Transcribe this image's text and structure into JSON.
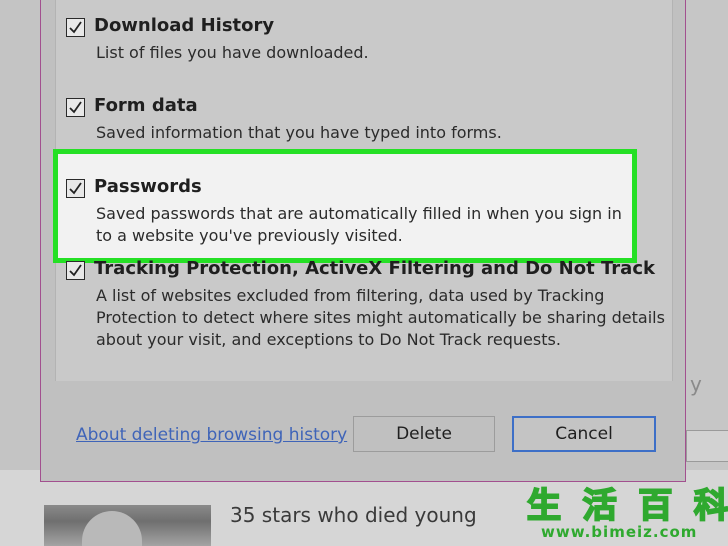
{
  "dialog": {
    "options": [
      {
        "title": "Download History",
        "description": [
          "List of files you have downloaded."
        ],
        "checked": true
      },
      {
        "title": "Form data",
        "description": [
          "Saved information that you have typed into forms."
        ],
        "checked": true
      },
      {
        "title": "Passwords",
        "description": [
          "Saved passwords that are automatically filled in when you sign in",
          "to a website you've previously visited."
        ],
        "checked": true
      },
      {
        "title": "Tracking Protection, ActiveX Filtering and Do Not Track",
        "description": [
          "A list of websites excluded from filtering, data used by Tracking",
          "Protection to detect where sites might automatically be sharing details",
          "about your visit, and exceptions to Do Not Track requests."
        ],
        "checked": true
      }
    ],
    "link_text": "About deleting browsing history",
    "delete_label": "Delete",
    "cancel_label": "Cancel"
  },
  "background": {
    "headline": "35 stars who died young",
    "right_fragment": "y"
  },
  "watermark": {
    "chars": [
      "生",
      "活",
      "百",
      "科"
    ],
    "url": "www.bimeiz.com"
  },
  "colors": {
    "highlight_border": "#25e025",
    "link": "#3f64b8",
    "cancel_border": "#3d6fc7",
    "dialog_border": "#a2508f"
  },
  "icons": {
    "checkbox": "checkmark-icon"
  }
}
